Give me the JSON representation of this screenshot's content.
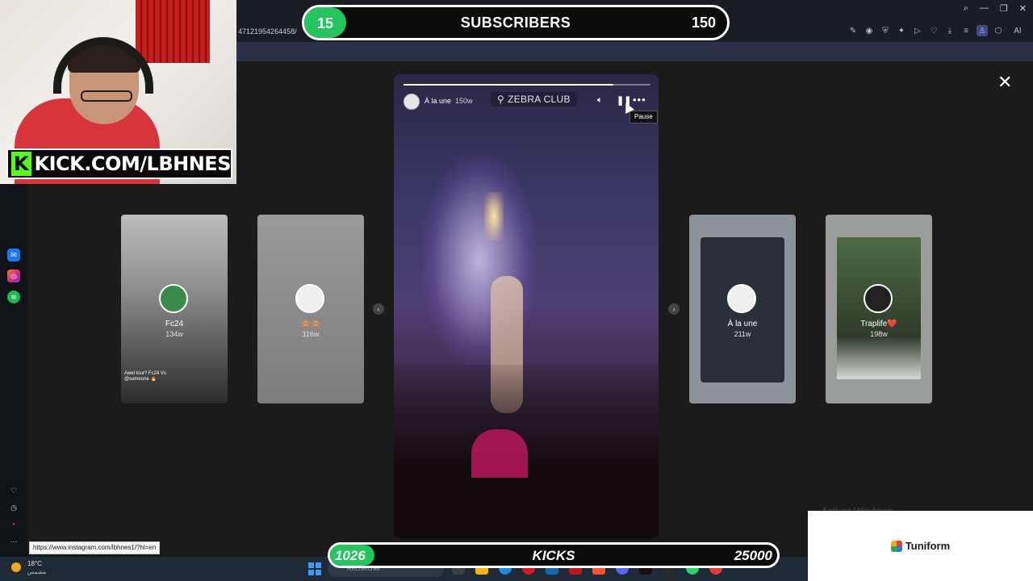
{
  "browser": {
    "url_fragment": "47121954264458/",
    "toolbar_icons": [
      "edit-icon",
      "camera-icon",
      "shield-icon",
      "extension-icon",
      "play-icon",
      "heart-icon",
      "download-icon",
      "menu-icon",
      "profile-icon",
      "box-icon",
      "ai-icon"
    ],
    "ai_label": "AI",
    "status_link": "https://www.instagram.com/lbhnes1/?hl=en",
    "sidebar_apps": [
      "messenger-icon",
      "instagram-icon",
      "spotify-icon",
      "heart-icon",
      "history-icon",
      "record-icon",
      "more-icon"
    ]
  },
  "webcam": {
    "kick_logo": "K",
    "kick_url": "KICK.COM/LBHNES"
  },
  "subscriber_goal": {
    "current": "15",
    "label": "SUBSCRIBERS",
    "target": "150",
    "progress_fraction": 0.1,
    "fill_color": "#22c55e"
  },
  "story": {
    "username": "À la une",
    "age": "150w",
    "location": "ZEBRA CLUB",
    "progress_fraction": 0.85,
    "tooltip": "Pause",
    "controls": [
      "volume-icon",
      "pause-icon",
      "more-icon"
    ]
  },
  "thumbnails": [
    {
      "name": "Fc24",
      "age": "134w",
      "caption": "Awel tour? Fc24 Vs @someone 🔥"
    },
    {
      "name": "🙈🙈",
      "age": "116w",
      "caption": ""
    },
    {
      "name": "À la une",
      "age": "211w",
      "caption": ""
    },
    {
      "name": "Traplife❤️",
      "age": "198w",
      "caption": ""
    }
  ],
  "kicks_goal": {
    "current": "1026",
    "label": "KICKS",
    "target": "25000",
    "progress_fraction": 0.04,
    "fill_color": "#22c55e"
  },
  "taskbar": {
    "weather_temp": "18°C",
    "weather_desc": "مشمس",
    "search_placeholder": "Rechercher",
    "activate_windows": "Activer Windows"
  },
  "tuniform": {
    "name": "Tuniform"
  }
}
